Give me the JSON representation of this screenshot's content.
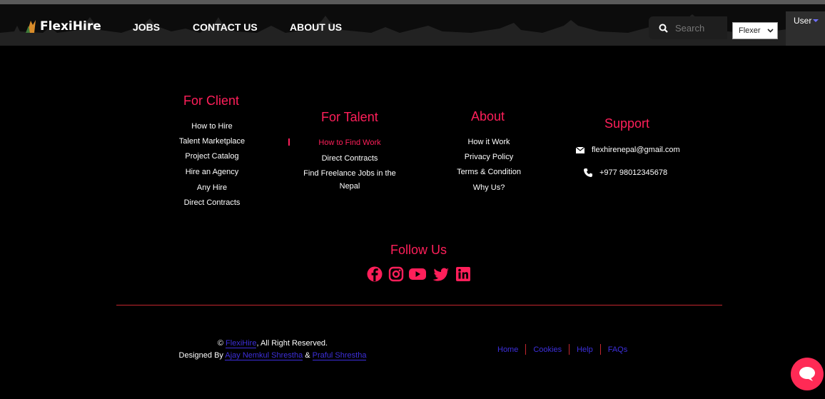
{
  "brand": {
    "name": "FlexiHire"
  },
  "nav": {
    "jobs": "JOBS",
    "contact": "CONTACT US",
    "about": "ABOUT US"
  },
  "search": {
    "placeholder": "Search",
    "value": ""
  },
  "role_select": {
    "value": "Flexer"
  },
  "user_menu": {
    "label": "User"
  },
  "columns": {
    "client": {
      "title": "For Client",
      "links": [
        "How to Hire",
        "Talent Marketplace",
        "Project Catalog",
        "Hire an Agency",
        "Any Hire",
        "Direct Contracts"
      ]
    },
    "talent": {
      "title": "For Talent",
      "links": [
        "How to Find Work",
        "Direct Contracts",
        "Find Freelance Jobs in the",
        "Nepal"
      ]
    },
    "about": {
      "title": "About",
      "links": [
        "How it Work",
        "Privacy Policy",
        "Terms & Condition",
        "Why Us?"
      ]
    },
    "support": {
      "title": "Support",
      "email": "flexhirenepal@gmail.com",
      "phone": "+977 98012345678"
    }
  },
  "follow": {
    "title": "Follow Us",
    "icons": [
      "facebook-icon",
      "instagram-icon",
      "youtube-icon",
      "twitter-icon",
      "linkedin-icon"
    ]
  },
  "footer": {
    "copyright_prefix": "© ",
    "copyright_brand": "FlexiHire",
    "copyright_suffix": ", All Right Reserved.",
    "designed_by": "Designed By ",
    "designer1": "Ajay Nemkul Shrestha",
    "and": " & ",
    "designer2": "Praful Shrestha",
    "links": [
      "Home",
      "Cookies",
      "Help",
      "FAQs"
    ]
  },
  "colors": {
    "accent": "#ff1f5a",
    "link_blue": "#3d2fdd",
    "divider": "#c4262e",
    "chat": "#ff2a55"
  }
}
